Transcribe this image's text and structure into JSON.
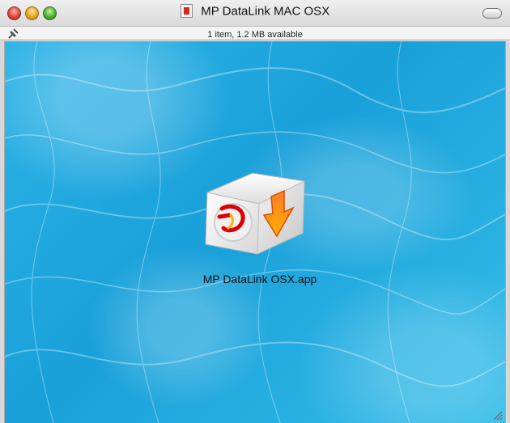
{
  "window": {
    "title": "MP DataLink MAC OSX",
    "status_text": "1 item, 1.2 MB available"
  },
  "icons": {
    "close": "close-button",
    "minimize": "minimize-button",
    "zoom": "zoom-button",
    "title": "disk-image-icon",
    "toolbar": "toolbar-toggle-button",
    "pin": "pin-icon",
    "app": "application-icon",
    "resize": "resize-grip-icon"
  },
  "content": {
    "items": [
      {
        "label": "MP DataLink OSX.app",
        "type": "application"
      }
    ]
  },
  "colors": {
    "water_background": "#1aa0d9",
    "close": "#e0443a",
    "minimize": "#e6a61c",
    "zoom": "#4fae2f"
  }
}
